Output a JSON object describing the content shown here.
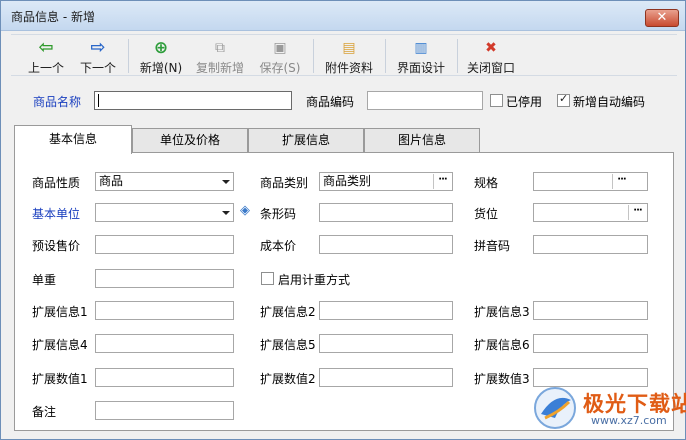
{
  "window": {
    "title": "商品信息 - 新增",
    "close_label": "✕"
  },
  "toolbar": [
    {
      "id": "prev",
      "label": "上一个",
      "icon": "arrow-left-icon",
      "glyph": "⇦",
      "color": "#2f9a2c",
      "disabled": false
    },
    {
      "id": "next",
      "label": "下一个",
      "icon": "arrow-right-icon",
      "glyph": "⇨",
      "color": "#2a67c9",
      "disabled": false
    },
    {
      "id": "new",
      "label": "新增(N)",
      "icon": "plus-circle-icon",
      "glyph": "⊕",
      "color": "#2e9d3b",
      "disabled": false
    },
    {
      "id": "copy",
      "label": "复制新增",
      "icon": "copy-icon",
      "glyph": "⧉",
      "color": "#9a9a9a",
      "disabled": true
    },
    {
      "id": "save",
      "label": "保存(S)",
      "icon": "save-icon",
      "glyph": "▣",
      "color": "#9a9a9a",
      "disabled": true
    },
    {
      "id": "attach",
      "label": "附件资料",
      "icon": "attachment-icon",
      "glyph": "▤",
      "color": "#d9a13a",
      "disabled": false
    },
    {
      "id": "layout",
      "label": "界面设计",
      "icon": "layout-design-icon",
      "glyph": "▥",
      "color": "#3a7fd0",
      "disabled": false
    },
    {
      "id": "close",
      "label": "关闭窗口",
      "icon": "close-window-icon",
      "glyph": "✖",
      "color": "#d23a2a",
      "disabled": false
    }
  ],
  "header": {
    "name_label": "商品名称",
    "name_value": "",
    "code_label": "商品编码",
    "code_value": "",
    "disabled_label": "已停用",
    "disabled_checked": false,
    "autocode_label": "新增自动编码",
    "autocode_checked": true
  },
  "tabs": [
    "基本信息",
    "单位及价格",
    "扩展信息",
    "图片信息"
  ],
  "active_tab": 0,
  "form": {
    "property_label": "商品性质",
    "property_value": "商品",
    "category_label": "商品类别",
    "category_value": "商品类别",
    "spec_label": "规格",
    "spec_value": "",
    "base_unit_label": "基本单位",
    "base_unit_value": "",
    "barcode_label": "条形码",
    "barcode_value": "",
    "location_label": "货位",
    "location_value": "",
    "preset_price_label": "预设售价",
    "preset_price_value": "",
    "cost_label": "成本价",
    "cost_value": "",
    "pinyin_label": "拼音码",
    "pinyin_value": "",
    "unit_weight_label": "单重",
    "unit_weight_value": "",
    "weighing_label": "启用计重方式",
    "weighing_checked": false,
    "ext1_label": "扩展信息1",
    "ext2_label": "扩展信息2",
    "ext3_label": "扩展信息3",
    "ext4_label": "扩展信息4",
    "ext5_label": "扩展信息5",
    "ext6_label": "扩展信息6",
    "num1_label": "扩展数值1",
    "num2_label": "扩展数值2",
    "num3_label": "扩展数值3",
    "remark_label": "备注"
  },
  "watermark": {
    "brand": "极光下载站",
    "url": "www.xz7.com"
  },
  "colors": {
    "label_blue": "#1a3fbf",
    "title_bar": "#c4d8ef"
  }
}
